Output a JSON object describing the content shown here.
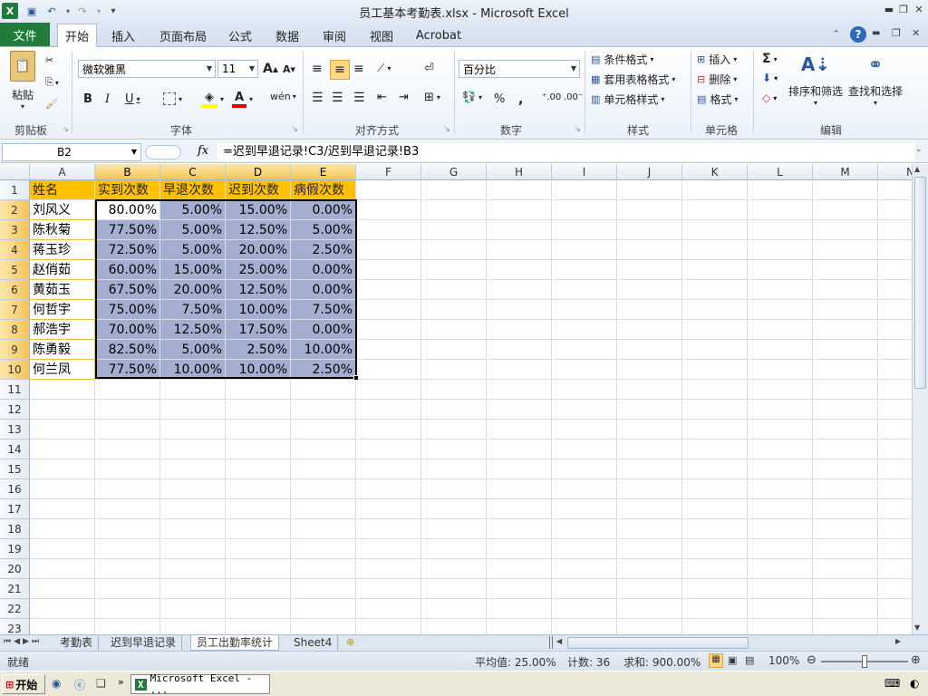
{
  "window": {
    "title": "员工基本考勤表.xlsx - Microsoft Excel"
  },
  "ribbon_tabs": [
    "文件",
    "开始",
    "插入",
    "页面布局",
    "公式",
    "数据",
    "审阅",
    "视图",
    "Acrobat"
  ],
  "active_tab": "开始",
  "clipboard": {
    "paste": "粘贴",
    "group": "剪贴板"
  },
  "font": {
    "name": "微软雅黑",
    "size": "11",
    "group": "字体",
    "bold": "B",
    "italic": "I",
    "underline": "U",
    "grow": "A",
    "shrink": "A",
    "font_color": "A",
    "wen": "wén"
  },
  "alignment": {
    "group": "对齐方式"
  },
  "number": {
    "format": "百分比",
    "group": "数字",
    "percent": "%",
    "comma": ","
  },
  "styles": {
    "conditional": "条件格式",
    "table": "套用表格格式",
    "cell_styles": "单元格样式",
    "group": "样式"
  },
  "cells": {
    "insert": "插入",
    "delete": "删除",
    "format": "格式",
    "group": "单元格"
  },
  "editing": {
    "sort": "排序和筛选",
    "find": "查找和选择",
    "group": "编辑"
  },
  "formula_bar": {
    "name_box": "B2",
    "fx": "fx",
    "formula": "=迟到早退记录!C3/迟到早退记录!B3"
  },
  "columns": [
    "A",
    "B",
    "C",
    "D",
    "E",
    "F",
    "G",
    "H",
    "I",
    "J",
    "K",
    "L",
    "M",
    "N"
  ],
  "rows": [
    "1",
    "2",
    "3",
    "4",
    "5",
    "6",
    "7",
    "8",
    "9",
    "10",
    "11",
    "12",
    "13",
    "14",
    "15",
    "16",
    "17",
    "18",
    "19",
    "20",
    "21",
    "22",
    "23"
  ],
  "table": {
    "headers": [
      "姓名",
      "实到次数",
      "早退次数",
      "迟到次数",
      "病假次数"
    ],
    "data": [
      [
        "刘风义",
        "80.00%",
        "5.00%",
        "15.00%",
        "0.00%"
      ],
      [
        "陈秋菊",
        "77.50%",
        "5.00%",
        "12.50%",
        "5.00%"
      ],
      [
        "蒋玉珍",
        "72.50%",
        "5.00%",
        "20.00%",
        "2.50%"
      ],
      [
        "赵俏茹",
        "60.00%",
        "15.00%",
        "25.00%",
        "0.00%"
      ],
      [
        "黄茹玉",
        "67.50%",
        "20.00%",
        "12.50%",
        "0.00%"
      ],
      [
        "何哲宇",
        "75.00%",
        "7.50%",
        "10.00%",
        "7.50%"
      ],
      [
        "郝浩宇",
        "70.00%",
        "12.50%",
        "17.50%",
        "0.00%"
      ],
      [
        "陈勇毅",
        "82.50%",
        "5.00%",
        "2.50%",
        "10.00%"
      ],
      [
        "何兰凤",
        "77.50%",
        "10.00%",
        "10.00%",
        "2.50%"
      ]
    ]
  },
  "sheets": [
    "考勤表",
    "迟到早退记录",
    "员工出勤率统计",
    "Sheet4"
  ],
  "active_sheet": "员工出勤率统计",
  "status": {
    "ready": "就绪",
    "average": "平均值: 25.00%",
    "count": "计数: 36",
    "sum": "求和: 900.00%",
    "zoom": "100%"
  },
  "taskbar": {
    "start": "开始",
    "app": "Microsoft Excel - ..."
  },
  "colors": {
    "header_fill": "#ffc000",
    "selection_fill": "#a4aed0",
    "file_tab": "#217b3c"
  }
}
